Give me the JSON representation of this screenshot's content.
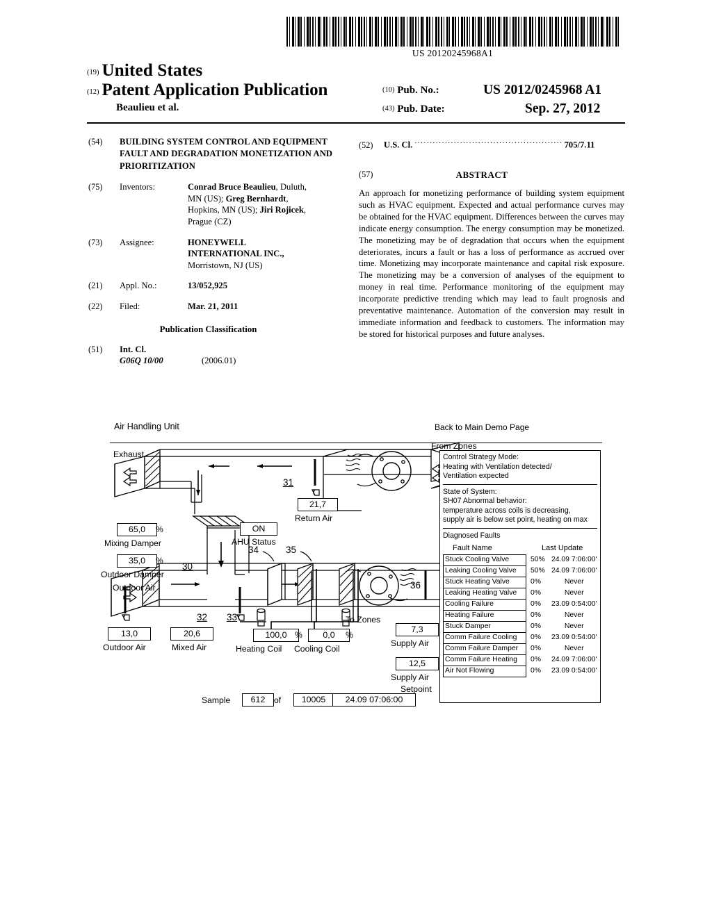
{
  "barcode": {
    "number": "US 20120245968A1"
  },
  "masthead": {
    "kind_19": "(19)",
    "country": "United States",
    "kind_12": "(12)",
    "doc_type": "Patent Application Publication",
    "authors": "Beaulieu et al.",
    "pubno_num": "(10)",
    "pubno_label": "Pub. No.:",
    "pubno_value": "US 2012/0245968 A1",
    "pubdate_num": "(43)",
    "pubdate_label": "Pub. Date:",
    "pubdate_value": "Sep. 27, 2012"
  },
  "left_column": {
    "title": {
      "num": "(54)",
      "text": "BUILDING SYSTEM CONTROL AND EQUIPMENT FAULT AND DEGRADATION MONETIZATION AND PRIORITIZATION"
    },
    "inventors": {
      "num": "(75)",
      "key": "Inventors:",
      "line1_bold": "Conrad Bruce Beaulieu",
      "line1_rest": ", Duluth,",
      "line2_rest": "MN (US); ",
      "line2_bold": "Greg Bernhardt",
      "line2_tail": ",",
      "line3_rest": "Hopkins, MN (US); ",
      "line3_bold": "Jiri Rojicek",
      "line3_tail": ",",
      "line4": "Prague (CZ)"
    },
    "assignee": {
      "num": "(73)",
      "key": "Assignee:",
      "line1": "HONEYWELL",
      "line2": "INTERNATIONAL INC.,",
      "line3": "Morristown, NJ (US)"
    },
    "appl_no": {
      "num": "(21)",
      "key": "Appl. No.:",
      "value": "13/052,925"
    },
    "filed": {
      "num": "(22)",
      "key": "Filed:",
      "value": "Mar. 21, 2011"
    },
    "pub_classification_heading": "Publication Classification",
    "int_cl": {
      "num": "(51)",
      "key": "Int. Cl.",
      "code": "G06Q  10/00",
      "version": "(2006.01)"
    }
  },
  "right_column": {
    "us_cl": {
      "num": "(52)",
      "key": "U.S. Cl.",
      "dots": "......................................................................",
      "value": "705/7.11"
    },
    "abstract": {
      "num": "(57)",
      "heading": "ABSTRACT",
      "text": "An approach for monetizing performance of building system equipment such as HVAC equipment. Expected and actual performance curves may be obtained for the HVAC equipment. Differences between the curves may indicate energy consumption. The energy consumption may be monetized. The monetizing may be of degradation that occurs when the equipment deteriorates, incurs a fault or has a loss of performance as accrued over time. Monetizing may incorporate maintenance and capital risk exposure. The monetizing may be a conversion of analyses of the equipment to money in real time. Performance monitoring of the equipment may incorporate predictive trending which may lead to fault prognosis and preventative maintenance. Automation of the conversion may result in immediate information and feedback to customers. The information may be stored for historical purposes and future analyses."
    }
  },
  "figure": {
    "ahu_title": "Air Handling Unit",
    "back_link": "Back to Main Demo Page",
    "labels": {
      "exhaust": "Exhaust",
      "from_zones": "From Zones",
      "to_zones": "To Zones",
      "outdoor_air_duct": "Outdoor Air",
      "mixing_damper": "Mixing Damper",
      "outdoor_damper": "Outdoor Damper",
      "return_air": "Return Air",
      "ahu_status": "AHU Status",
      "outdoor_air_sensor": "Outdoor Air",
      "mixed_air": "Mixed Air",
      "heating_coil": "Heating Coil",
      "cooling_coil": "Cooling Coil",
      "supply_air": "Supply Air",
      "supply_air_setpoint_l1": "Supply Air",
      "supply_air_setpoint_l2": "Setpoint"
    },
    "values": {
      "mixing_damper": "65,0",
      "mixing_damper_unit": "%",
      "outdoor_damper": "35,0",
      "outdoor_damper_unit": "%",
      "return_air": "21,7",
      "ahu_status": "ON",
      "outdoor_air": "13,0",
      "mixed_air": "20,6",
      "heating_coil": "100,0",
      "heating_coil_unit": "%",
      "cooling_coil": "0,0",
      "cooling_coil_unit": "%",
      "supply_air": "7,3",
      "supply_air_setpoint": "12,5"
    },
    "ref_numerals": {
      "n30": "30",
      "n31": "31",
      "n32": "32",
      "n33": "33",
      "n34": "34",
      "n35": "35",
      "n36": "36"
    },
    "sample_bar": {
      "prefix": "Sample",
      "index": "612",
      "of": "of",
      "total": "10005",
      "timestamp": "24.09 07:06:00"
    }
  },
  "info_panel": {
    "control_strategy_label": "Control Strategy Mode:",
    "control_strategy_l1": "Heating with Ventilation detected/",
    "control_strategy_l2": "Ventilation expected",
    "state_label": "State of System:",
    "state_l1": "SH07 Abnormal behavior:",
    "state_l2": "temperature across coils is decreasing,",
    "state_l3": "supply air is below set point, heating on max",
    "diagnosed_faults_label": "Diagnosed Faults",
    "col_fault_name": "Fault Name",
    "col_last_update": "Last Update",
    "faults": [
      {
        "name": "Stuck Cooling Valve",
        "pct": "50%",
        "last_update": "24.09  7:06:00'"
      },
      {
        "name": "Leaking Cooling Valve",
        "pct": "50%",
        "last_update": "24.09  7:06:00'"
      },
      {
        "name": "Stuck Heating Valve",
        "pct": "0%",
        "last_update": "Never"
      },
      {
        "name": "Leaking Heating Valve",
        "pct": "0%",
        "last_update": "Never"
      },
      {
        "name": "Cooling Failure",
        "pct": "0%",
        "last_update": "23.09  0:54:00'"
      },
      {
        "name": "Heating Failure",
        "pct": "0%",
        "last_update": "Never"
      },
      {
        "name": "Stuck Damper",
        "pct": "0%",
        "last_update": "Never"
      },
      {
        "name": "Comm Failure Cooling",
        "pct": "0%",
        "last_update": "23.09  0:54:00'"
      },
      {
        "name": "Comm Failure Damper",
        "pct": "0%",
        "last_update": "Never"
      },
      {
        "name": "Comm Failure Heating",
        "pct": "0%",
        "last_update": "24.09  7:06:00'"
      },
      {
        "name": "Air Not Flowing",
        "pct": "0%",
        "last_update": "23.09  0:54:00'"
      }
    ]
  }
}
